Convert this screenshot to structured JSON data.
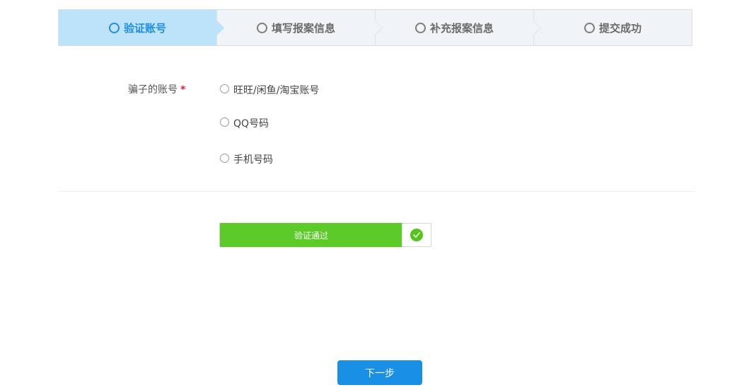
{
  "steps": [
    {
      "label": "验证账号",
      "active": true
    },
    {
      "label": "填写报案信息",
      "active": false
    },
    {
      "label": "补充报案信息",
      "active": false
    },
    {
      "label": "提交成功",
      "active": false
    }
  ],
  "form": {
    "account_label": "骗子的账号",
    "required_mark": "*",
    "options": [
      {
        "label": "旺旺/闲鱼/淘宝账号",
        "checked": false
      },
      {
        "label": "QQ号码",
        "checked": false
      },
      {
        "label": "手机号码",
        "checked": false
      }
    ]
  },
  "verify": {
    "text": "验证通过",
    "progress": 1.0,
    "color": "#5ccb27"
  },
  "next_button": {
    "label": "下一步"
  },
  "colors": {
    "accent": "#1a8fe6",
    "active_step_bg": "#bde3fb",
    "success": "#5ccb27",
    "required": "#e0202b"
  }
}
